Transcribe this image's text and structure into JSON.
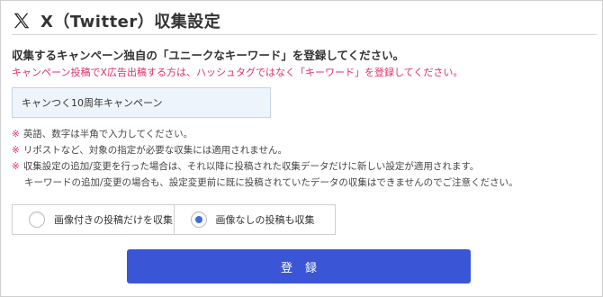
{
  "header": {
    "logo_icon": "x-logo-icon",
    "title": "X（Twitter）収集設定"
  },
  "form": {
    "instruction": "収集するキャンペーン独自の「ユニークなキーワード」を登録してください。",
    "warning": "キャンペーン投稿でX広告出稿する方は、ハッシュタグではなく「キーワード」を登録してください。",
    "keyword_value": "キャンつく10周年キャンペーン",
    "notes": [
      "英語、数字は半角で入力してください。",
      "リポストなど、対象の指定が必要な収集には適用されません。",
      "収集設定の追加/変更を行った場合は、それ以降に投稿された収集データだけに新しい設定が適用されます。"
    ],
    "note_mark": "※",
    "note_continuation": "キーワードの追加/変更の場合も、設定変更前に既に投稿されていたデータの収集はできませんのでご注意ください。",
    "radio_options": [
      {
        "label": "画像付きの投稿だけを収集",
        "checked": false
      },
      {
        "label": "画像なしの投稿も収集",
        "checked": true
      }
    ],
    "submit_label": "登録"
  },
  "colors": {
    "accent": "#3a56d6",
    "warning": "#e0306a",
    "input_bg": "#eef4fb"
  }
}
